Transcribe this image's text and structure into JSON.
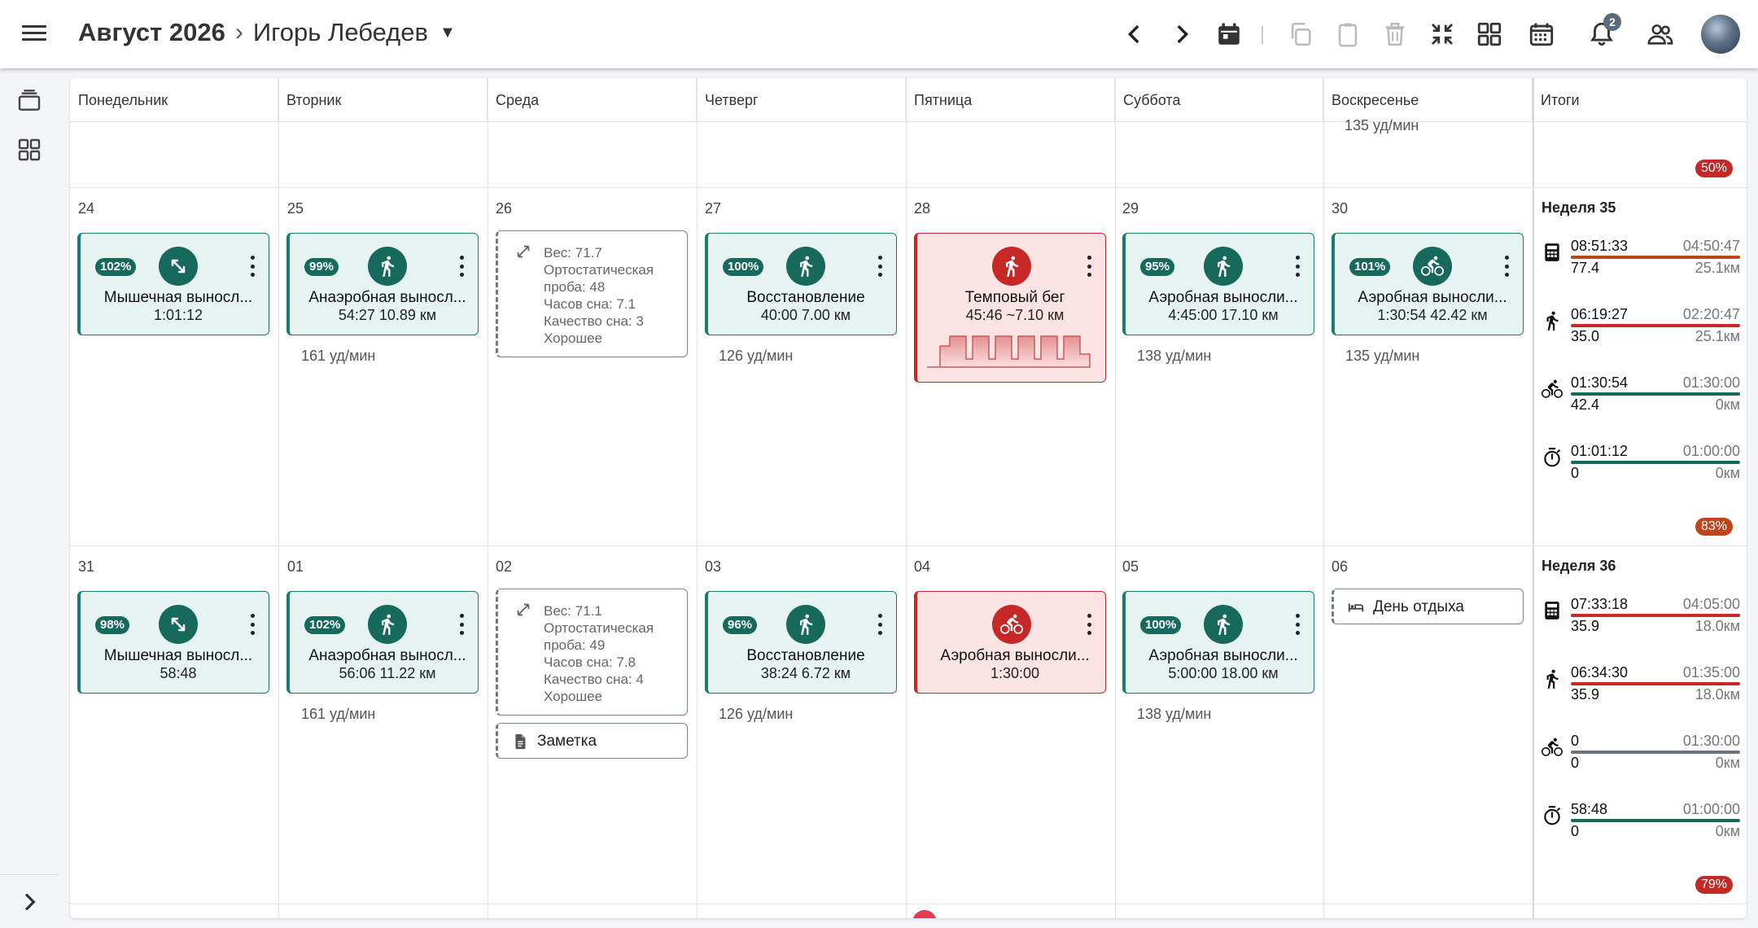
{
  "header": {
    "month": "Август 2026",
    "athlete": "Игорь Лебедев",
    "notifications_count": "2",
    "icons": [
      "menu-icon",
      "chevron-left-icon",
      "chevron-right-icon",
      "calendar-today-icon",
      "copy-icon",
      "paste-icon",
      "delete-icon",
      "fullscreen-exit-icon",
      "grid-icon",
      "calendar-month-icon",
      "bell-icon",
      "group-icon"
    ]
  },
  "columns": [
    "Понедельник",
    "Вторник",
    "Среда",
    "Четверг",
    "Пятница",
    "Суббота",
    "Воскресенье",
    "Итоги"
  ],
  "prev_week": {
    "sunday_bpm": "135 уд/мин",
    "total_badge": "50%"
  },
  "week35": {
    "days": [
      "24",
      "25",
      "26",
      "27",
      "28",
      "29",
      "30"
    ],
    "mon": {
      "pct": "102%",
      "title": "Мышечная выносл...",
      "sub": "1:01:12"
    },
    "tue": {
      "pct": "99%",
      "title": "Анаэробная выносл...",
      "sub": "54:27  10.89 км",
      "bpm": "161 уд/мин"
    },
    "wed": {
      "lines": [
        "Вес: 71.7",
        "Ортостатическая",
        "проба: 48",
        "Часов сна: 7.1",
        "Качество сна: 3",
        "Хорошее"
      ]
    },
    "thu": {
      "pct": "100%",
      "title": "Восстановление",
      "sub": "40:00  7.00 км",
      "bpm": "126 уд/мин"
    },
    "fri": {
      "title": "Темповый бег",
      "sub": "45:46  ~7.10 км"
    },
    "sat": {
      "pct": "95%",
      "title": "Аэробная выносли...",
      "sub": "4:45:00  17.10 км",
      "bpm": "138 уд/мин"
    },
    "sun": {
      "pct": "101%",
      "title": "Аэробная выносли...",
      "sub": "1:30:54  42.42 км",
      "bpm": "135 уд/мин"
    },
    "summary": {
      "label": "Неделя 35",
      "rows": [
        {
          "icon": "calculator-icon",
          "a": "08:51:33",
          "b": "04:50:47",
          "c": "77.4",
          "d": "25.1км",
          "color": "#c0441a"
        },
        {
          "icon": "run-icon",
          "a": "06:19:27",
          "b": "02:20:47",
          "c": "35.0",
          "d": "25.1км",
          "color": "#c62828"
        },
        {
          "icon": "bike-icon",
          "a": "01:30:54",
          "b": "01:30:00",
          "c": "42.4",
          "d": "0км",
          "color": "#17695c"
        },
        {
          "icon": "stopwatch-icon",
          "a": "01:01:12",
          "b": "01:00:00",
          "c": "0",
          "d": "0км",
          "color": "#17695c"
        }
      ],
      "badge": "83%",
      "badge_color": "#c0441a"
    }
  },
  "week36": {
    "days": [
      "31",
      "01",
      "02",
      "03",
      "04",
      "05",
      "06"
    ],
    "mon": {
      "pct": "98%",
      "title": "Мышечная выносл...",
      "sub": "58:48"
    },
    "tue": {
      "pct": "102%",
      "title": "Анаэробная выносл...",
      "sub": "56:06  11.22 км",
      "bpm": "161 уд/мин"
    },
    "wed": {
      "lines": [
        "Вес: 71.1",
        "Ортостатическая",
        "проба: 49",
        "Часов сна: 7.8",
        "Качество сна: 4",
        "Хорошее"
      ],
      "note": "Заметка"
    },
    "thu": {
      "pct": "96%",
      "title": "Восстановление",
      "sub": "38:24  6.72 км",
      "bpm": "126 уд/мин"
    },
    "fri": {
      "title": "Аэробная выносли...",
      "sub": "1:30:00"
    },
    "sat": {
      "pct": "100%",
      "title": "Аэробная выносли...",
      "sub": "5:00:00  18.00 км",
      "bpm": "138 уд/мин"
    },
    "sun": {
      "rest": "День отдыха"
    },
    "summary": {
      "label": "Неделя 36",
      "rows": [
        {
          "icon": "calculator-icon",
          "a": "07:33:18",
          "b": "04:05:00",
          "c": "35.9",
          "d": "18.0км",
          "color": "#c62828"
        },
        {
          "icon": "run-icon",
          "a": "06:34:30",
          "b": "01:35:00",
          "c": "35.9",
          "d": "18.0км",
          "color": "#c62828"
        },
        {
          "icon": "bike-icon",
          "a": "0",
          "b": "01:30:00",
          "c": "0",
          "d": "0км",
          "color": "#6b7580"
        },
        {
          "icon": "stopwatch-icon",
          "a": "58:48",
          "b": "01:00:00",
          "c": "0",
          "d": "0км",
          "color": "#17695c"
        }
      ],
      "badge": "79%",
      "badge_color": "#c62828"
    }
  }
}
